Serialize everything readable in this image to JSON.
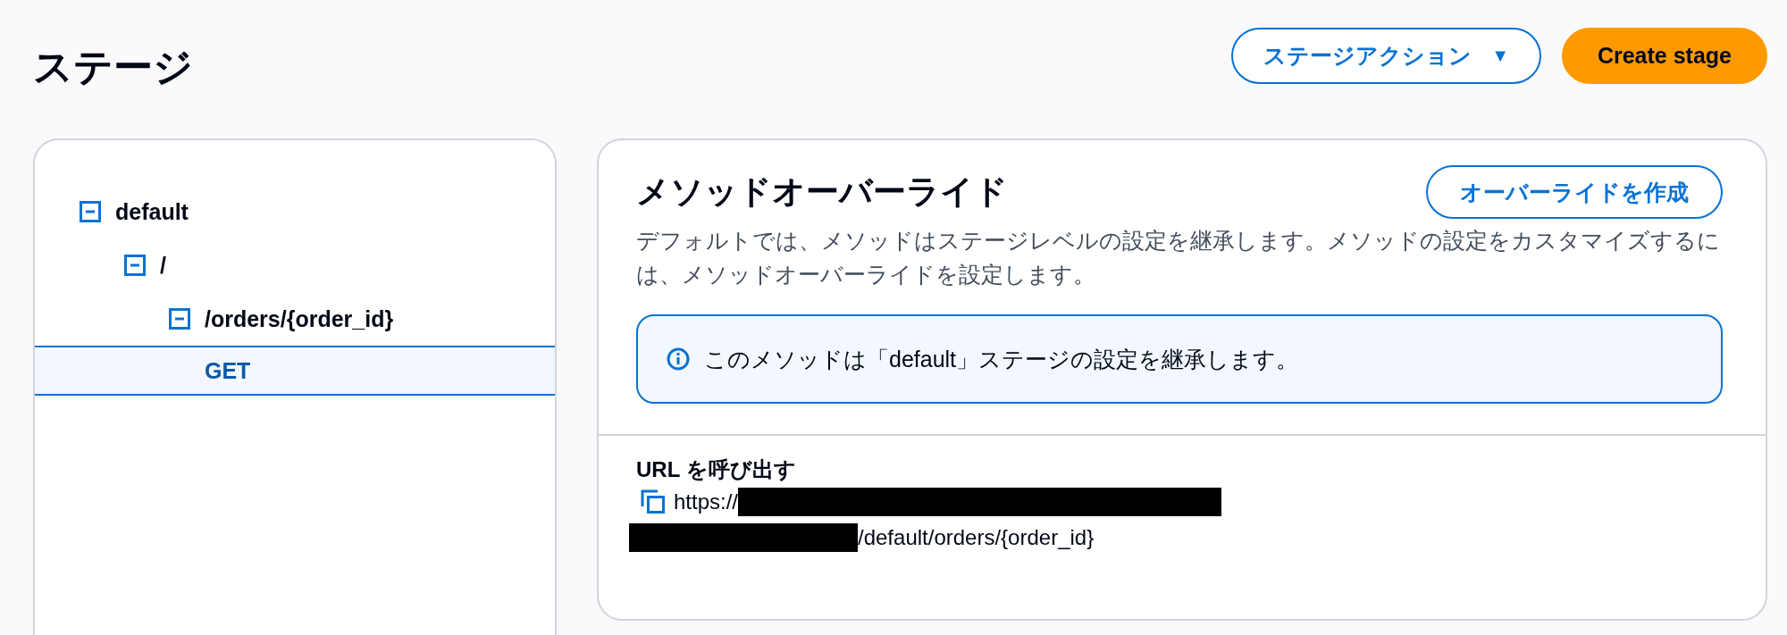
{
  "page": {
    "title": "ステージ"
  },
  "actions": [
    {
      "label": "ステージアクション",
      "kind": "dropdown",
      "caret": "▼"
    },
    {
      "label": "Create stage",
      "kind": "primary"
    }
  ],
  "tree": [
    {
      "label": "default",
      "expanded": true,
      "selected": false,
      "children": [
        {
          "label": "/",
          "expanded": true,
          "selected": false,
          "children": [
            {
              "label": "/orders/{order_id}",
              "expanded": true,
              "selected": false,
              "children": [
                {
                  "label": "GET",
                  "kind": "method",
                  "selected": true
                }
              ]
            }
          ]
        }
      ]
    }
  ],
  "override": {
    "title": "メソッドオーバーライド",
    "button": "オーバーライドを作成",
    "description": "デフォルトでは、メソッドはステージレベルの設定を継承します。メソッドの設定をカスタマイズするには、メソッドオーバーライドを設定します。",
    "info": "このメソッドは「default」ステージの設定を継承します。"
  },
  "invoke_url": {
    "label": "URL を呼び出す",
    "prefix": "https://",
    "suffix": "/default/orders/{order_id}"
  }
}
